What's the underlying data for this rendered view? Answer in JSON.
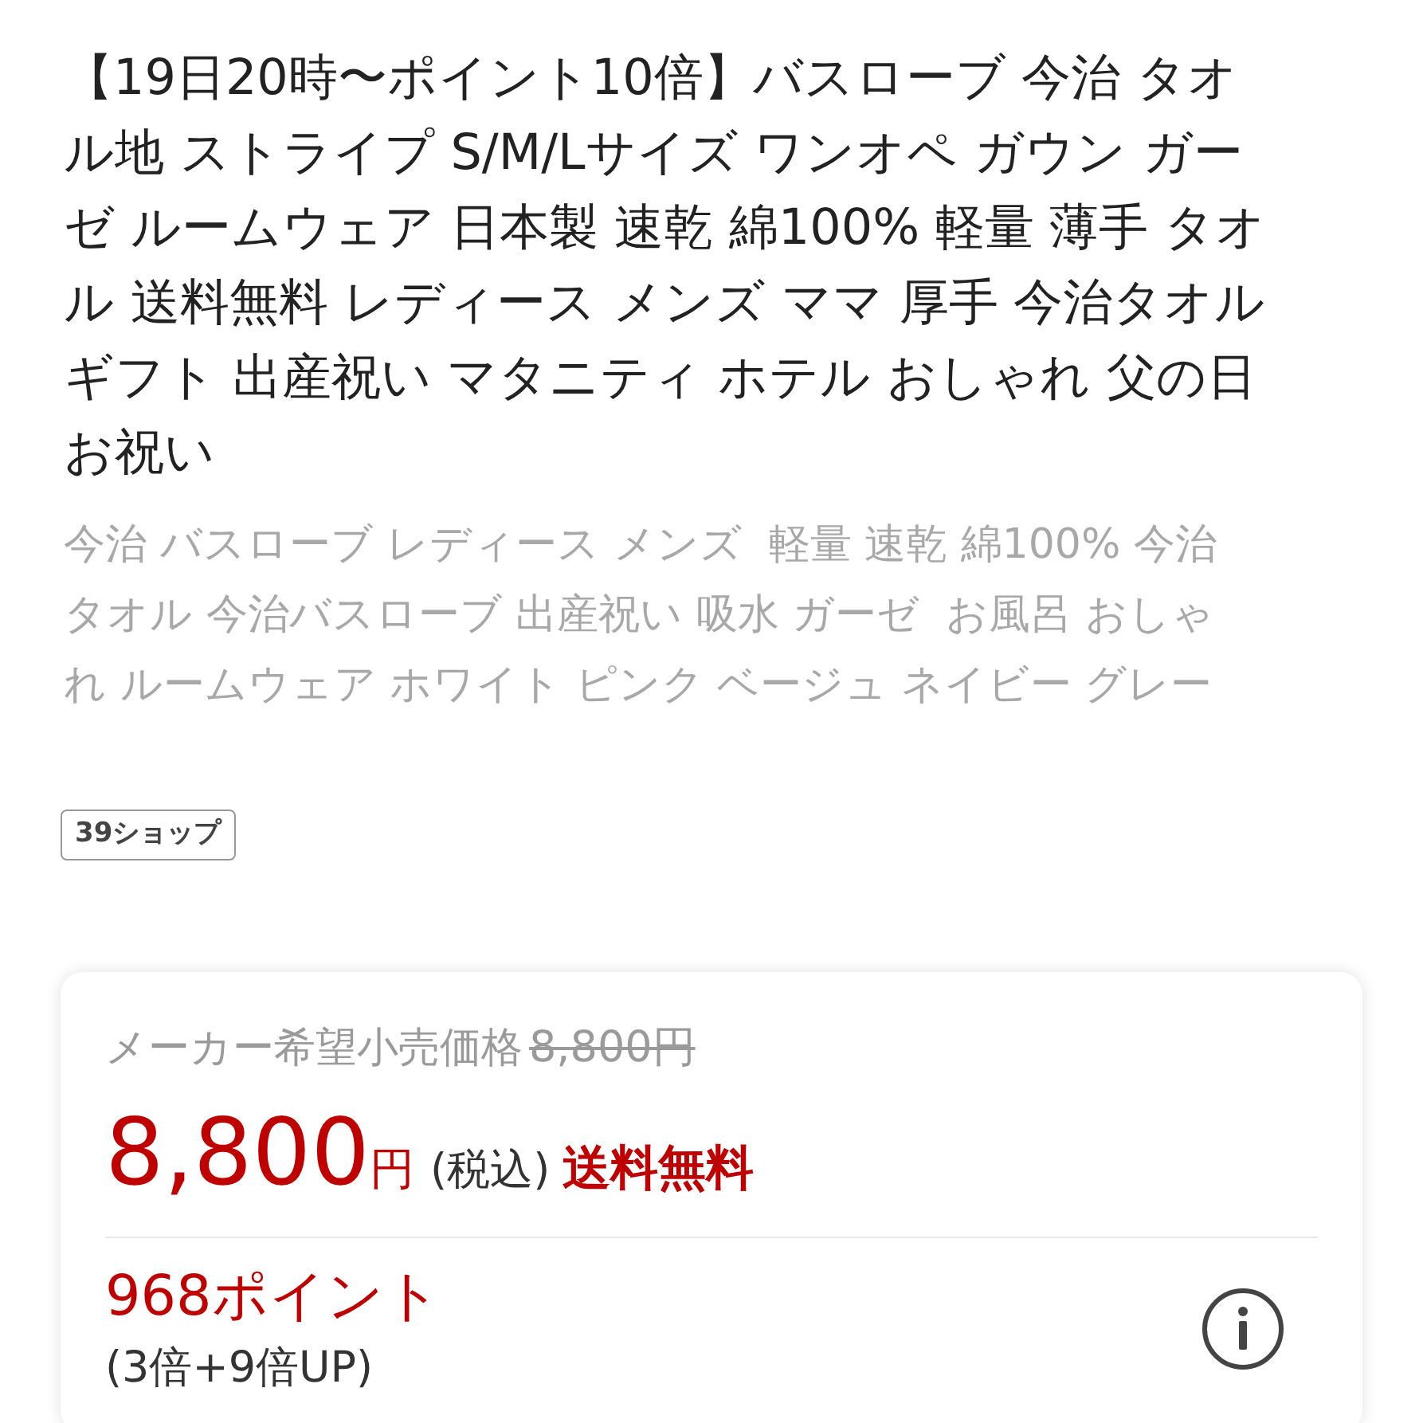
{
  "product": {
    "title_lines": [
      "【19日20時〜ポイント10倍】バスローブ 今治 タオ",
      "ル地 ストライプ S/M/Lサイズ ワンオペ ガウン ガー",
      "ゼ ルームウェア 日本製 速乾 綿100% 軽量 薄手 タオ",
      "ル 送料無料 レディース メンズ ママ 厚手 今治タオル",
      "ギフト 出産祝い マタニティ ホテル おしゃれ 父の日",
      "お祝い"
    ],
    "subtitle_lines": [
      "今治 バスローブ レディース メンズ  軽量 速乾 綿100% 今治",
      "タオル 今治バスローブ 出産祝い 吸水 ガーゼ  お風呂 おしゃ",
      "れ ルームウェア ホワイト ピンク ベージュ ネイビー グレー"
    ],
    "shop_badge": "39ショップ"
  },
  "price_card": {
    "list_price_label": "メーカー希望小売価格",
    "list_price": "8,800円",
    "price": "8,800",
    "currency": "円",
    "tax_note": "(税込)",
    "shipping": "送料無料",
    "points": "968ポイント",
    "points_detail": "(3倍+9倍UP)"
  }
}
